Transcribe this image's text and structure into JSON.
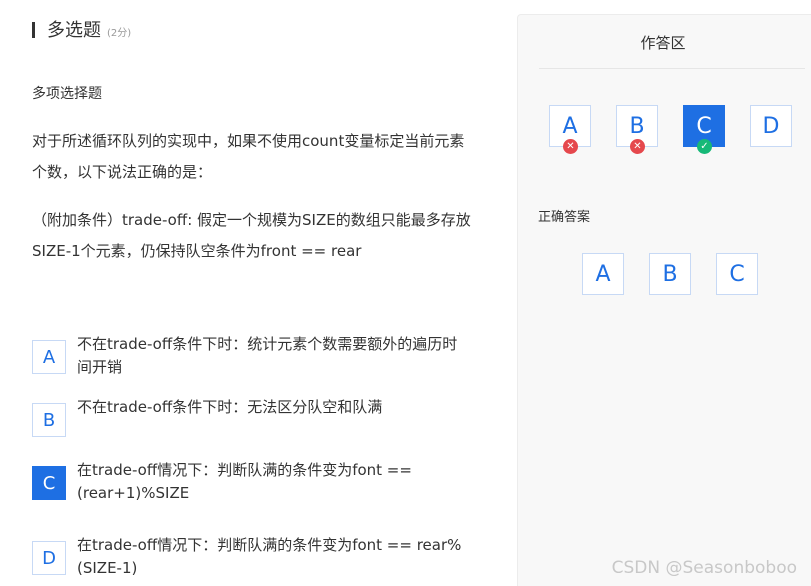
{
  "question": {
    "title": "多选题",
    "score": "(2分)",
    "type_label": "多项选择题",
    "stem": [
      "对于所述循环队列的实现中，如果不使用count变量标定当前元素个数，以下说法正确的是：",
      "（附加条件）trade-off: 假定一个规模为SIZE的数组只能最多存放SIZE-1个元素，仍保持队空条件为front == rear"
    ],
    "options": [
      {
        "letter": "A",
        "text": "不在trade-off条件下时：统计元素个数需要额外的遍历时间开销",
        "selected": false
      },
      {
        "letter": "B",
        "text": "不在trade-off条件下时：无法区分队空和队满",
        "selected": false
      },
      {
        "letter": "C",
        "text": "在trade-off情况下：判断队满的条件变为font == (rear+1)%SIZE",
        "selected": true
      },
      {
        "letter": "D",
        "text": "在trade-off情况下：判断队满的条件变为font == rear%(SIZE-1)",
        "selected": false
      }
    ]
  },
  "answer_panel": {
    "title": "作答区",
    "choices": [
      {
        "letter": "A",
        "status": "wrong",
        "status_icon": "cross-icon"
      },
      {
        "letter": "B",
        "status": "wrong",
        "status_icon": "cross-icon"
      },
      {
        "letter": "C",
        "status": "correct",
        "status_icon": "check-icon",
        "selected": true
      },
      {
        "letter": "D",
        "status": "none"
      }
    ],
    "correct_label": "正确答案",
    "correct_answers": [
      "A",
      "B",
      "C"
    ]
  },
  "watermark": "CSDN @Seasonboboo",
  "colors": {
    "accent": "#1e6fe3",
    "wrong": "#e5484d",
    "correct": "#17b978"
  }
}
